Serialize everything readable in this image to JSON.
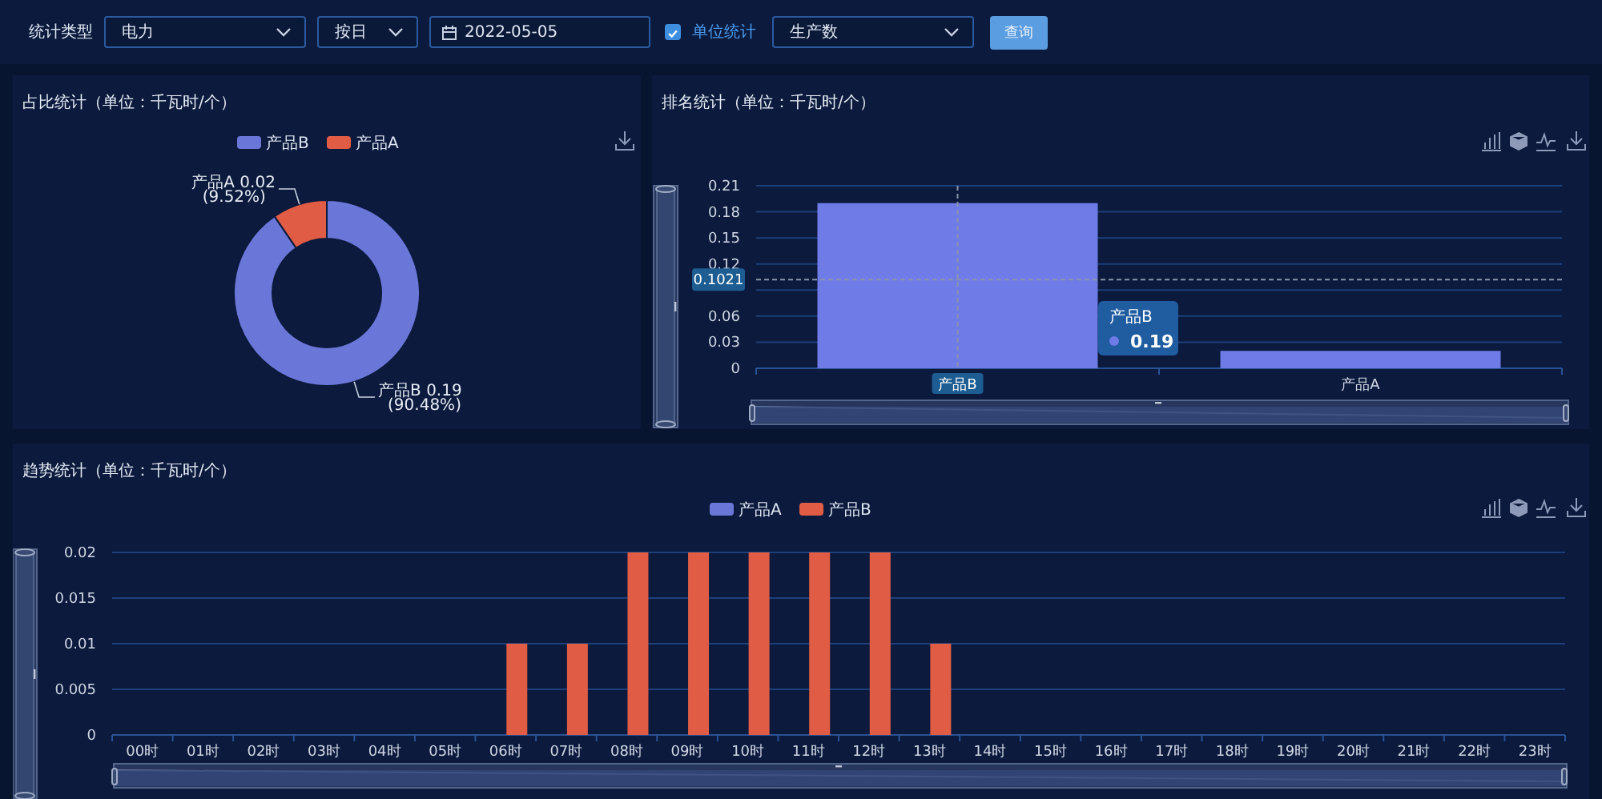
{
  "filters": {
    "type_label": "统计类型",
    "type_select": "电力",
    "period_select": "按日",
    "date_field": "2022-05-05",
    "unit_checkbox": {
      "label": "单位统计",
      "checked": true
    },
    "metric_select": "生产数",
    "query_button": "查询"
  },
  "share_panel": {
    "title": "占比统计（单位：千瓦时/个）",
    "legend": [
      {
        "label": "产品B",
        "color": "#6b77d8"
      },
      {
        "label": "产品A",
        "color": "#e05c45"
      }
    ],
    "chart_data": {
      "type": "donut",
      "categories": [
        "产品B",
        "产品A"
      ],
      "values": [
        90.48,
        9.52
      ],
      "value_labels": [
        [
          "0.19",
          "(90.48%)"
        ],
        [
          "0.02",
          "(9.52%)"
        ]
      ]
    }
  },
  "ranking_panel": {
    "title": "排名统计（单位：千瓦时/个）",
    "y_zoom": {
      "level": 1
    },
    "x_zoom": {
      "level": 1
    },
    "tooltip": {
      "title": "产品B",
      "value": "0.19"
    },
    "chart_data": {
      "type": "bar",
      "categories": [
        "产品B",
        "产品A"
      ],
      "grid": true,
      "series": [
        {
          "color": "#6f7be6",
          "values": [
            0.19,
            0.02
          ]
        }
      ],
      "ylim": [
        0,
        0.21
      ],
      "yticks": [
        0,
        0.03,
        0.06,
        0.12,
        0.15,
        0.18,
        0.21
      ],
      "ref_lines": [
        {
          "axis": "y",
          "value": 0.1021,
          "label": "0.1021"
        },
        {
          "axis": "x",
          "value": "产品B"
        }
      ]
    }
  },
  "trend_panel": {
    "title": "趋势统计（单位：千瓦时/个）",
    "y_zoom": {
      "level": 1
    },
    "x_zoom": {
      "level": 1
    },
    "chart_data": {
      "type": "bar",
      "grid": true,
      "categories": [
        "00时",
        "01时",
        "02时",
        "03时",
        "04时",
        "05时",
        "06时",
        "07时",
        "08时",
        "09时",
        "10时",
        "11时",
        "12时",
        "13时",
        "14时",
        "15时",
        "16时",
        "17时",
        "18时",
        "19时",
        "20时",
        "21时",
        "22时",
        "23时"
      ],
      "series": [
        {
          "name": "产品A",
          "color": "#6b77d8",
          "values": [
            0,
            0,
            0,
            0,
            0,
            0,
            0,
            0,
            0,
            0,
            0,
            0,
            0,
            0,
            0,
            0,
            0,
            0,
            0,
            0,
            0,
            0,
            0,
            0
          ]
        },
        {
          "name": "产品B",
          "color": "#e05c45",
          "values": [
            0,
            0,
            0,
            0,
            0,
            0,
            0.01,
            0.01,
            0.02,
            0.02,
            0.02,
            0.02,
            0.02,
            0.01,
            0,
            0,
            0,
            0,
            0,
            0,
            0,
            0,
            0,
            0
          ]
        }
      ],
      "ylim": [
        0,
        0.02
      ],
      "yticks": [
        0,
        0.005,
        0.01,
        0.015,
        0.02
      ]
    }
  }
}
